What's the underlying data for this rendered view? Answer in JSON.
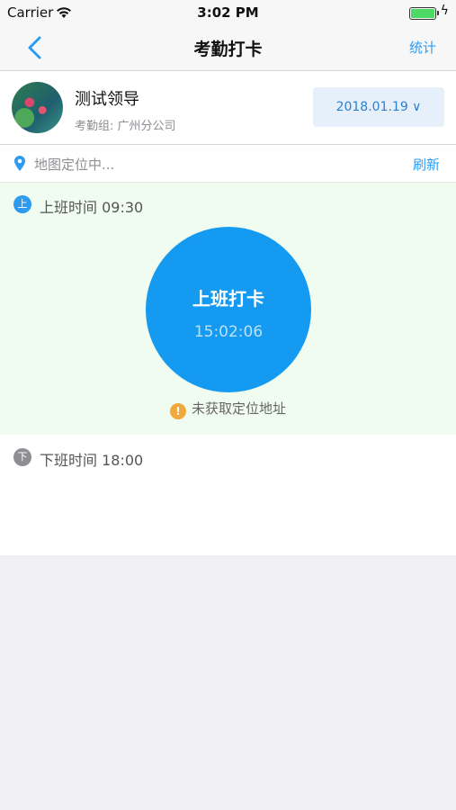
{
  "status_bar": {
    "carrier": "Carrier",
    "time": "3:02 PM"
  },
  "nav": {
    "title": "考勤打卡",
    "right_action": "统计"
  },
  "profile": {
    "name": "测试领导",
    "group": "考勤组: 广州分公司",
    "date_button": "2018.01.19 ∨"
  },
  "location": {
    "text": "地图定位中...",
    "refresh": "刷新"
  },
  "checkin": {
    "badge": "上",
    "label": "上班时间 09:30",
    "button_title": "上班打卡",
    "button_time": "15:02:06",
    "warning": "未获取定位地址"
  },
  "checkout": {
    "badge": "下",
    "label": "下班时间 18:00"
  },
  "colors": {
    "accent": "#149af0",
    "link": "#2d9cf0",
    "checkin_bg": "#f1fcf0",
    "warning": "#f0a93a"
  }
}
